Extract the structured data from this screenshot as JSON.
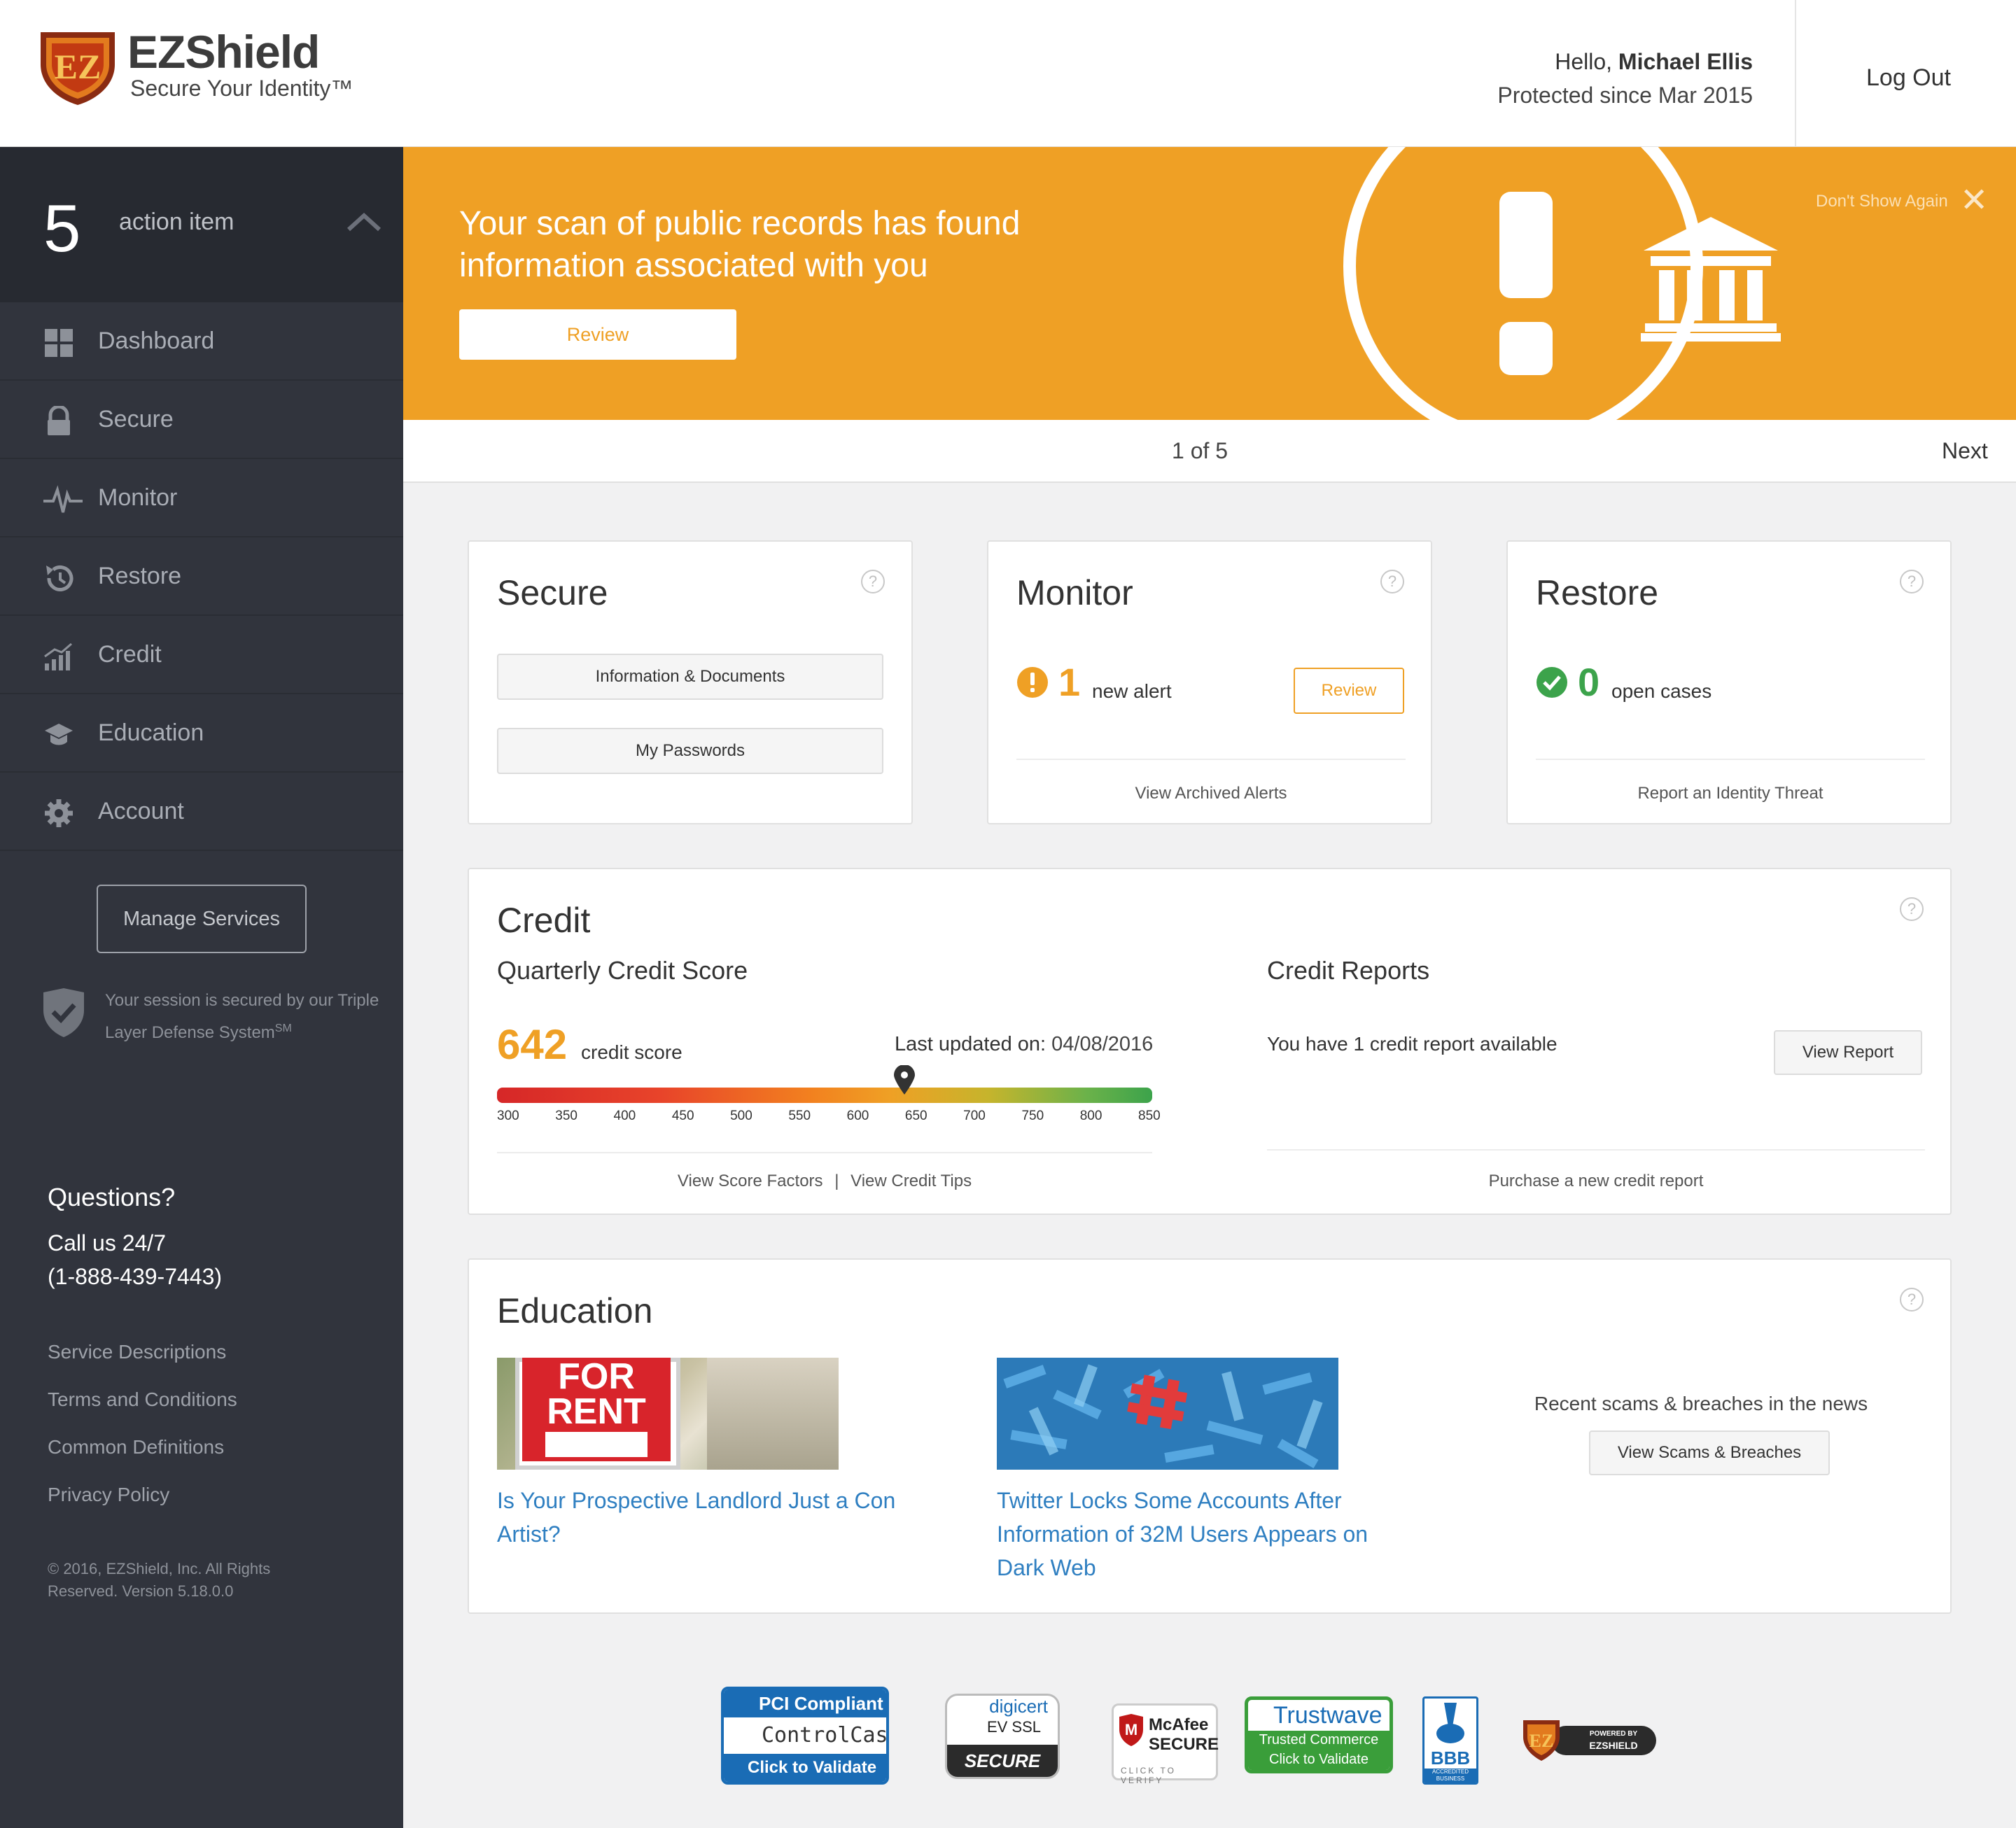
{
  "brand": {
    "name": "EZShield",
    "tagline": "Secure Your Identity™"
  },
  "header": {
    "hello": "Hello,",
    "user_name": "Michael Ellis",
    "protected_since": "Protected since Mar 2015",
    "logout": "Log Out"
  },
  "sidebar": {
    "action_count": "5",
    "action_label": "action item",
    "nav": [
      {
        "label": "Dashboard",
        "icon": "grid-icon"
      },
      {
        "label": "Secure",
        "icon": "lock-icon"
      },
      {
        "label": "Monitor",
        "icon": "pulse-icon"
      },
      {
        "label": "Restore",
        "icon": "history-icon"
      },
      {
        "label": "Credit",
        "icon": "bar-chart-icon"
      },
      {
        "label": "Education",
        "icon": "graduation-cap-icon"
      },
      {
        "label": "Account",
        "icon": "gear-icon"
      }
    ],
    "manage_services": "Manage Services",
    "session_text": "Your session is secured by our Triple Layer Defense System",
    "session_sup": "SM",
    "questions_title": "Questions?",
    "call_label": "Call us 24/7",
    "phone": "(1-888-439-7443)",
    "links": [
      "Service Descriptions",
      "Terms and Conditions",
      "Common Definitions",
      "Privacy Policy"
    ],
    "copyright": "© 2016, EZShield, Inc. All Rights Reserved. Version 5.18.0.0"
  },
  "banner": {
    "message": "Your scan of public records has found information associated with you",
    "review": "Review",
    "dont_show": "Don't Show Again",
    "close": "✕",
    "pager": "1 of 5",
    "next": "Next",
    "color": "#efa025"
  },
  "secure_card": {
    "title": "Secure",
    "btn1": "Information & Documents",
    "btn2": "My Passwords"
  },
  "monitor_card": {
    "title": "Monitor",
    "count": "1",
    "label": "new alert",
    "review": "Review",
    "link": "View Archived Alerts"
  },
  "restore_card": {
    "title": "Restore",
    "count": "0",
    "label": "open cases",
    "link": "Report an Identity Threat"
  },
  "credit_card": {
    "title": "Credit",
    "score_title": "Quarterly Credit Score",
    "score": "642",
    "score_label": "credit score",
    "updated_label": "Last updated on:",
    "updated_date": "04/08/2016",
    "scale": [
      "300",
      "350",
      "400",
      "450",
      "500",
      "550",
      "600",
      "650",
      "700",
      "750",
      "800",
      "850"
    ],
    "scale_min": 300,
    "scale_max": 850,
    "score_value": 642,
    "factors_link": "View Score Factors",
    "separator": "|",
    "tips_link": "View Credit Tips",
    "reports_title": "Credit Reports",
    "reports_text": "You have 1 credit report available",
    "view_report": "View Report",
    "purchase_link": "Purchase a new credit report"
  },
  "education_card": {
    "title": "Education",
    "articles": [
      {
        "title": "Is Your Prospective Landlord Just a Con Artist?",
        "sign_top": "FOR",
        "sign_bottom": "RENT"
      },
      {
        "title": "Twitter Locks Some Accounts After Information of 32M Users Appears on Dark Web"
      }
    ],
    "scams_text": "Recent scams & breaches in the news",
    "scams_btn": "View Scams & Breaches"
  },
  "footer_badges": {
    "pci": {
      "line1": "PCI Compliant",
      "line2": "ControlCase",
      "line3": "Click to Validate"
    },
    "digicert": {
      "line1": "digicert",
      "line2": "EV SSL",
      "line3": "SECURE"
    },
    "mcafee": {
      "line1": "McAfee",
      "line2": "SECURE",
      "line3": "CLICK TO VERIFY"
    },
    "trustwave": {
      "line1": "Trustwave",
      "line2": "Trusted Commerce",
      "line3": "Click to Validate"
    },
    "bbb": {
      "line1": "BBB",
      "line2": "ACCREDITED BUSINESS"
    },
    "ezshield": {
      "line1": "POWERED BY",
      "line2": "EZSHIELD"
    }
  },
  "colors": {
    "accent": "#efa025",
    "sidebar": "#31343d",
    "link_blue": "#2f7fc1",
    "success": "#3ca34b"
  }
}
